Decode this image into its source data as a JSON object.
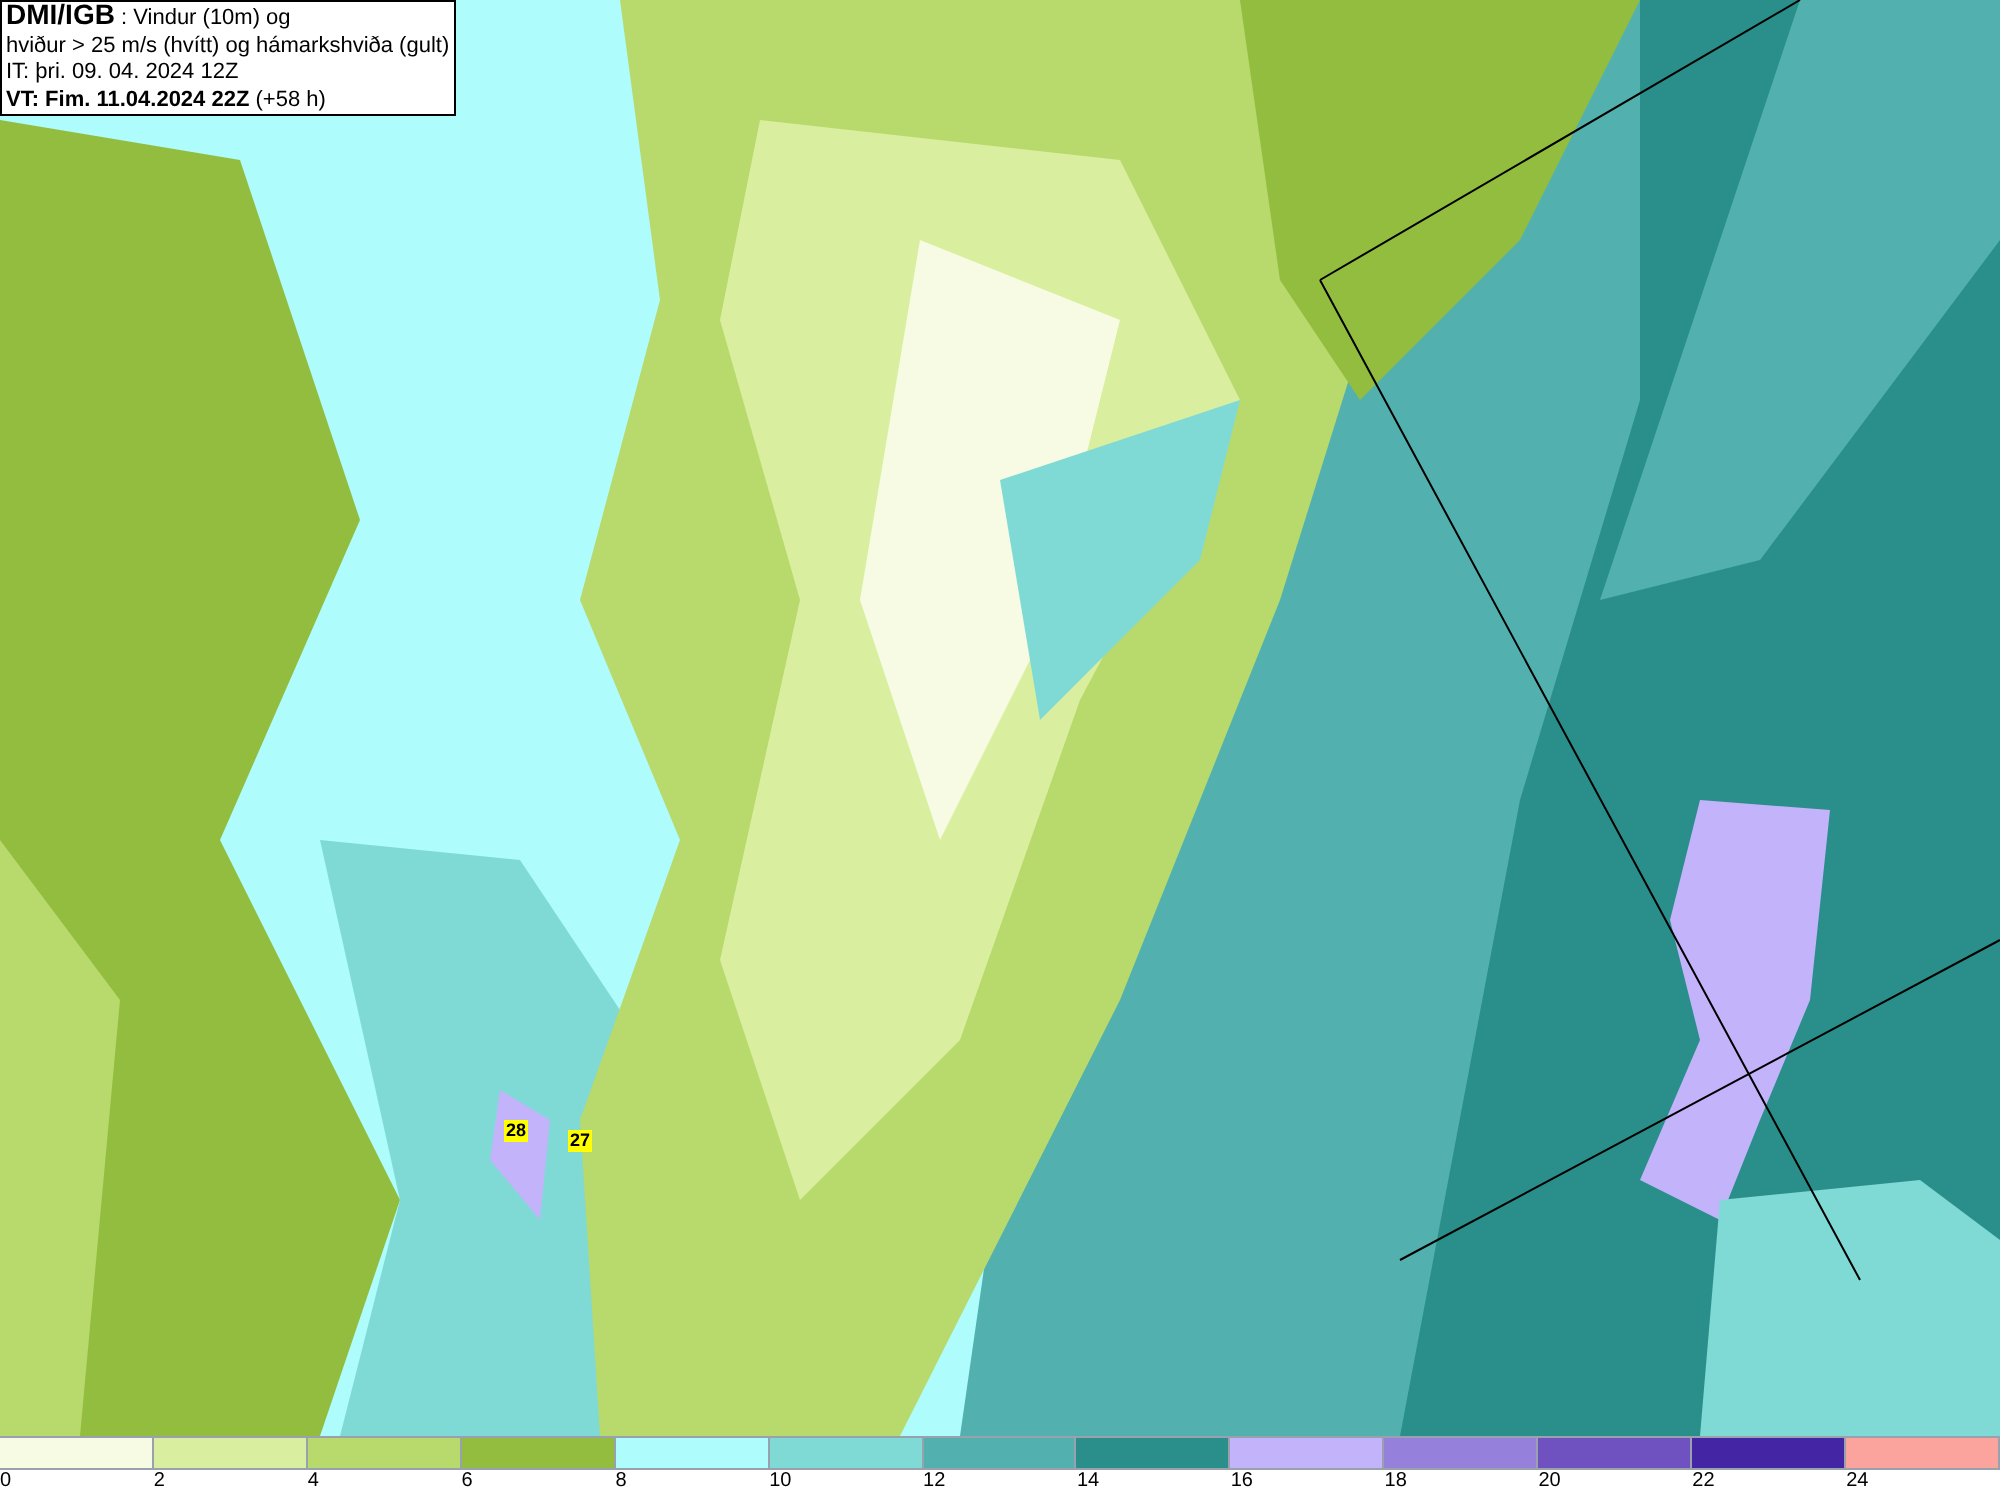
{
  "title_box": {
    "source": "DMI/IGB",
    "description_1": ": Vindur (10m) og",
    "description_2": "hviður > 25 m/s (hvítt) og hámarkshviða (gult)",
    "issue_time": "IT: þri. 09. 04. 2024 12Z",
    "valid_time": "VT: Fim. 11.04.2024 22Z",
    "lead_time": "(+58 h)"
  },
  "map": {
    "gust_markers": [
      "28",
      "27"
    ]
  },
  "legend": {
    "bins": [
      {
        "color": "#f7fbe3"
      },
      {
        "color": "#d9ef9f"
      },
      {
        "color": "#b8d96c"
      },
      {
        "color": "#93bd3e"
      },
      {
        "color": "#aefcfc"
      },
      {
        "color": "#7fdad6"
      },
      {
        "color": "#52b1ae"
      },
      {
        "color": "#2a8f8a"
      },
      {
        "color": "#c2b3fb"
      },
      {
        "color": "#9580dc"
      },
      {
        "color": "#6f52c0"
      },
      {
        "color": "#4426a4"
      },
      {
        "color": "#fba39d"
      }
    ],
    "ticks": [
      "0",
      "2",
      "4",
      "6",
      "8",
      "10",
      "12",
      "14",
      "16",
      "18",
      "20",
      "22",
      "24"
    ]
  }
}
